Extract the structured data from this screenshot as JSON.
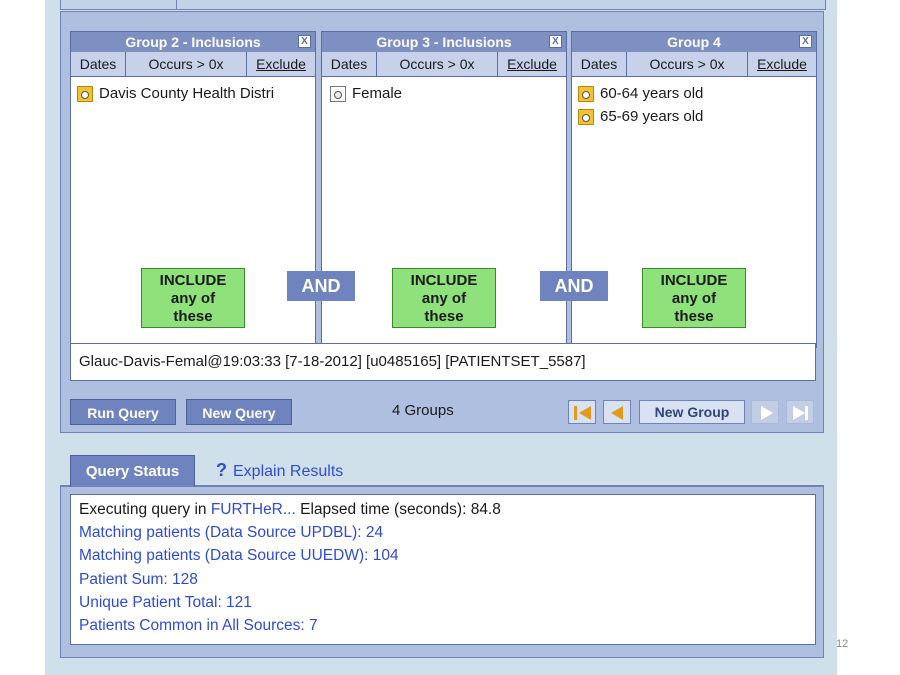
{
  "groups": [
    {
      "title": "Group 2 - Inclusions",
      "close": "X",
      "tabs": {
        "dates": "Dates",
        "occurs": "Occurs > 0x",
        "exclude": "Exclude"
      },
      "items": [
        {
          "label": "Davis County Health Distri",
          "icon": "folder-icon"
        }
      ],
      "include": {
        "line1": "INCLUDE",
        "line2": "any of",
        "line3": "these"
      }
    },
    {
      "title": "Group 3 - Inclusions",
      "close": "X",
      "tabs": {
        "dates": "Dates",
        "occurs": "Occurs > 0x",
        "exclude": "Exclude"
      },
      "items": [
        {
          "label": "Female",
          "icon": "document-icon"
        }
      ],
      "include": {
        "line1": "INCLUDE",
        "line2": "any of",
        "line3": "these"
      }
    },
    {
      "title": "Group 4",
      "close": "X",
      "tabs": {
        "dates": "Dates",
        "occurs": "Occurs > 0x",
        "exclude": "Exclude"
      },
      "items": [
        {
          "label": "60-64 years old",
          "icon": "folder-icon"
        },
        {
          "label": "65-69 years old",
          "icon": "folder-icon"
        }
      ],
      "include": {
        "line1": "INCLUDE",
        "line2": "any of",
        "line3": "these"
      }
    }
  ],
  "connectors": [
    "AND",
    "AND"
  ],
  "query_name": "Glauc-Davis-Femal@19:03:33 [7-18-2012] [u0485165] [PATIENTSET_5587]",
  "toolbar": {
    "run_query": "Run Query",
    "new_query": "New Query",
    "group_count": "4 Groups",
    "new_group": "New Group"
  },
  "status": {
    "tab_label": "Query Status",
    "explain_label": "Explain Results",
    "line1_prefix": "Executing query in ",
    "line1_link": "FURTHeR...",
    "line1_suffix": " Elapsed time (seconds): 84.8",
    "lines": [
      "Matching patients (Data Source UPDBL): 24",
      "Matching patients (Data Source UUEDW): 104",
      "Patient Sum: 128",
      "Unique Patient Total: 121",
      "Patients Common in All Sources: 7"
    ]
  },
  "page_number": "12",
  "colors": {
    "panel_bg": "#aebfe0",
    "header_blue": "#7e8fc2",
    "button_blue": "#6f84bf",
    "include_green": "#8fe27b",
    "link_blue": "#2f4bd0",
    "nav_orange": "#e09a1c"
  }
}
